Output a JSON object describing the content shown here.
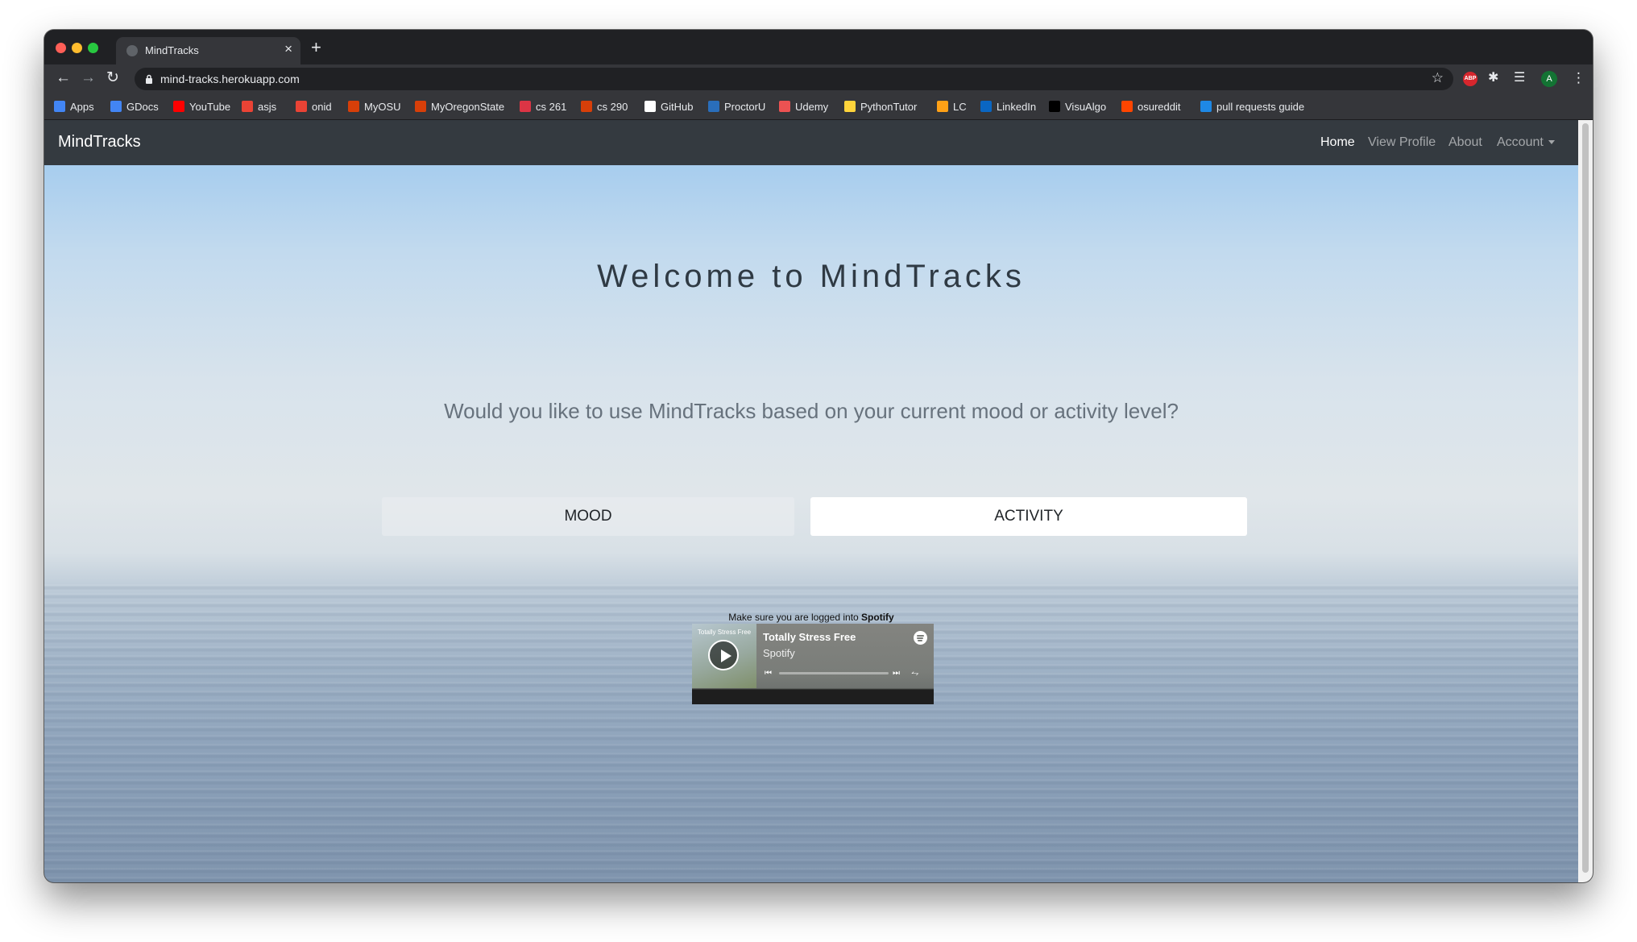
{
  "browser": {
    "tab_title": "MindTracks",
    "new_tab": "+",
    "tab_close": "×",
    "url": "mind-tracks.herokuapp.com",
    "avatar_initial": "A",
    "abp_label": "ABP",
    "icons": {
      "back": "arrow-left-icon",
      "forward": "arrow-right-icon",
      "reload": "reload-icon",
      "lock": "lock-icon",
      "star": "star-icon",
      "extensions": "puzzle-icon",
      "media": "media-queue-icon",
      "menu": "kebab-menu-icon"
    },
    "bookmarks": [
      {
        "label": "Apps",
        "color": "#4285f4"
      },
      {
        "label": "GDocs",
        "color": "#4285f4"
      },
      {
        "label": "YouTube",
        "color": "#ff0000"
      },
      {
        "label": "asjs",
        "color": "#ea4335"
      },
      {
        "label": "onid",
        "color": "#ea4335"
      },
      {
        "label": "MyOSU",
        "color": "#d73f09"
      },
      {
        "label": "MyOregonState",
        "color": "#d73f09"
      },
      {
        "label": "cs 261",
        "color": "#dc3545"
      },
      {
        "label": "cs 290",
        "color": "#d73f09"
      },
      {
        "label": "GitHub",
        "color": "#ffffff"
      },
      {
        "label": "ProctorU",
        "color": "#2a6ebb"
      },
      {
        "label": "Udemy",
        "color": "#ec5252"
      },
      {
        "label": "PythonTutor",
        "color": "#ffd43b"
      },
      {
        "label": "LC",
        "color": "#ffa116"
      },
      {
        "label": "LinkedIn",
        "color": "#0a66c2"
      },
      {
        "label": "VisuAlgo",
        "color": "#000000"
      },
      {
        "label": "osureddit",
        "color": "#ff4500"
      },
      {
        "label": "pull requests guide",
        "color": "#1e88e5"
      }
    ]
  },
  "site": {
    "brand": "MindTracks",
    "nav": {
      "home": "Home",
      "view_profile": "View Profile",
      "about": "About",
      "account": "Account"
    },
    "hero": {
      "title": "Welcome to MindTracks",
      "question": "Would you like to use MindTracks based on your current mood or activity level?",
      "mood_label": "MOOD",
      "activity_label": "ACTIVITY"
    },
    "spotify": {
      "note_prefix": "Make sure you are logged into",
      "note_brand": "Spotify",
      "cover_text": "Totally Stress Free",
      "track_title": "Totally Stress Free",
      "artist": "Spotify",
      "progress": 0
    }
  },
  "colors": {
    "navbar": "#343a40",
    "browser_chrome": "#35363a",
    "accent_spotify": "#1db954"
  }
}
